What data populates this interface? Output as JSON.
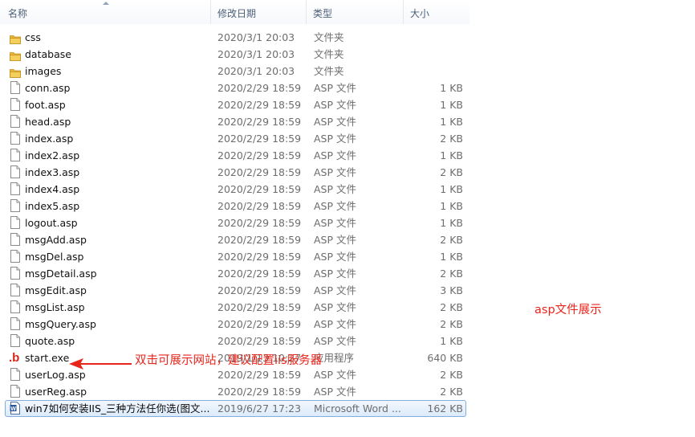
{
  "columns": {
    "name": "名称",
    "date": "修改日期",
    "type": "类型",
    "size": "大小"
  },
  "files": [
    {
      "name": "css",
      "date": "2020/3/1 20:03",
      "type": "文件夹",
      "size": "",
      "icon": "folder-icon"
    },
    {
      "name": "database",
      "date": "2020/3/1 20:03",
      "type": "文件夹",
      "size": "",
      "icon": "folder-icon"
    },
    {
      "name": "images",
      "date": "2020/3/1 20:03",
      "type": "文件夹",
      "size": "",
      "icon": "folder-icon"
    },
    {
      "name": "conn.asp",
      "date": "2020/2/29 18:59",
      "type": "ASP 文件",
      "size": "1 KB",
      "icon": "file-icon"
    },
    {
      "name": "foot.asp",
      "date": "2020/2/29 18:59",
      "type": "ASP 文件",
      "size": "1 KB",
      "icon": "file-icon"
    },
    {
      "name": "head.asp",
      "date": "2020/2/29 18:59",
      "type": "ASP 文件",
      "size": "1 KB",
      "icon": "file-icon"
    },
    {
      "name": "index.asp",
      "date": "2020/2/29 18:59",
      "type": "ASP 文件",
      "size": "2 KB",
      "icon": "file-icon"
    },
    {
      "name": "index2.asp",
      "date": "2020/2/29 18:59",
      "type": "ASP 文件",
      "size": "1 KB",
      "icon": "file-icon"
    },
    {
      "name": "index3.asp",
      "date": "2020/2/29 18:59",
      "type": "ASP 文件",
      "size": "2 KB",
      "icon": "file-icon"
    },
    {
      "name": "index4.asp",
      "date": "2020/2/29 18:59",
      "type": "ASP 文件",
      "size": "1 KB",
      "icon": "file-icon"
    },
    {
      "name": "index5.asp",
      "date": "2020/2/29 18:59",
      "type": "ASP 文件",
      "size": "1 KB",
      "icon": "file-icon"
    },
    {
      "name": "logout.asp",
      "date": "2020/2/29 18:59",
      "type": "ASP 文件",
      "size": "1 KB",
      "icon": "file-icon"
    },
    {
      "name": "msgAdd.asp",
      "date": "2020/2/29 18:59",
      "type": "ASP 文件",
      "size": "2 KB",
      "icon": "file-icon"
    },
    {
      "name": "msgDel.asp",
      "date": "2020/2/29 18:59",
      "type": "ASP 文件",
      "size": "1 KB",
      "icon": "file-icon"
    },
    {
      "name": "msgDetail.asp",
      "date": "2020/2/29 18:59",
      "type": "ASP 文件",
      "size": "2 KB",
      "icon": "file-icon"
    },
    {
      "name": "msgEdit.asp",
      "date": "2020/2/29 18:59",
      "type": "ASP 文件",
      "size": "3 KB",
      "icon": "file-icon"
    },
    {
      "name": "msgList.asp",
      "date": "2020/2/29 18:59",
      "type": "ASP 文件",
      "size": "2 KB",
      "icon": "file-icon"
    },
    {
      "name": "msgQuery.asp",
      "date": "2020/2/29 18:59",
      "type": "ASP 文件",
      "size": "2 KB",
      "icon": "file-icon"
    },
    {
      "name": "quote.asp",
      "date": "2020/2/29 18:59",
      "type": "ASP 文件",
      "size": "1 KB",
      "icon": "file-icon"
    },
    {
      "name": "start.exe",
      "date": "2019/1/13 10:27",
      "type": "应用程序",
      "size": "640 KB",
      "icon": "exe-icon"
    },
    {
      "name": "userLog.asp",
      "date": "2020/2/29 18:59",
      "type": "ASP 文件",
      "size": "2 KB",
      "icon": "file-icon"
    },
    {
      "name": "userReg.asp",
      "date": "2020/2/29 18:59",
      "type": "ASP 文件",
      "size": "2 KB",
      "icon": "file-icon"
    },
    {
      "name": "win7如何安装IIS_三种方法任你选(图文...",
      "date": "2019/6/27 17:23",
      "type": "Microsoft Word ...",
      "size": "162 KB",
      "icon": "word-doc-icon",
      "selected": true
    }
  ],
  "annotations": {
    "arrow_note": "双击可展示网站，建议配置iis服务器",
    "side_note": "asp文件展示",
    "color": "#e8251b"
  },
  "colors": {
    "header_text": "#4c607a",
    "selection_border": "#84acdd",
    "folder": "#e8b73a"
  }
}
